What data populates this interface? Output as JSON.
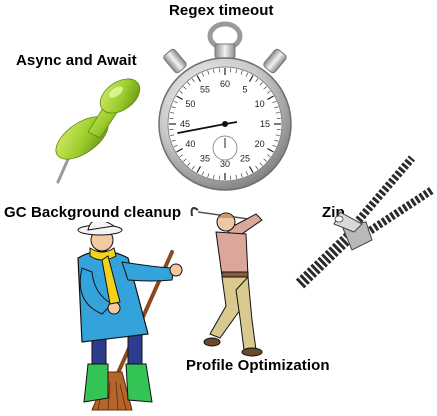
{
  "labels": {
    "regex": "Regex timeout",
    "async": "Async and Await",
    "gc": "GC Background cleanup",
    "zip": "Zip",
    "profile": "Profile Optimization"
  },
  "dial_numbers": [
    "55",
    "60",
    "5",
    "10",
    "15",
    "20",
    "25",
    "30",
    "35",
    "40",
    "45",
    "50"
  ],
  "colors": {
    "pushpin": "#9ccc2c",
    "jacket": "#34a3dc",
    "scarf": "#f2d21b",
    "boots": "#33c455",
    "golfer_shirt": "#dba79b",
    "golfer_pants": "#d9c98f",
    "zip_teeth": "#2b2b2b"
  }
}
